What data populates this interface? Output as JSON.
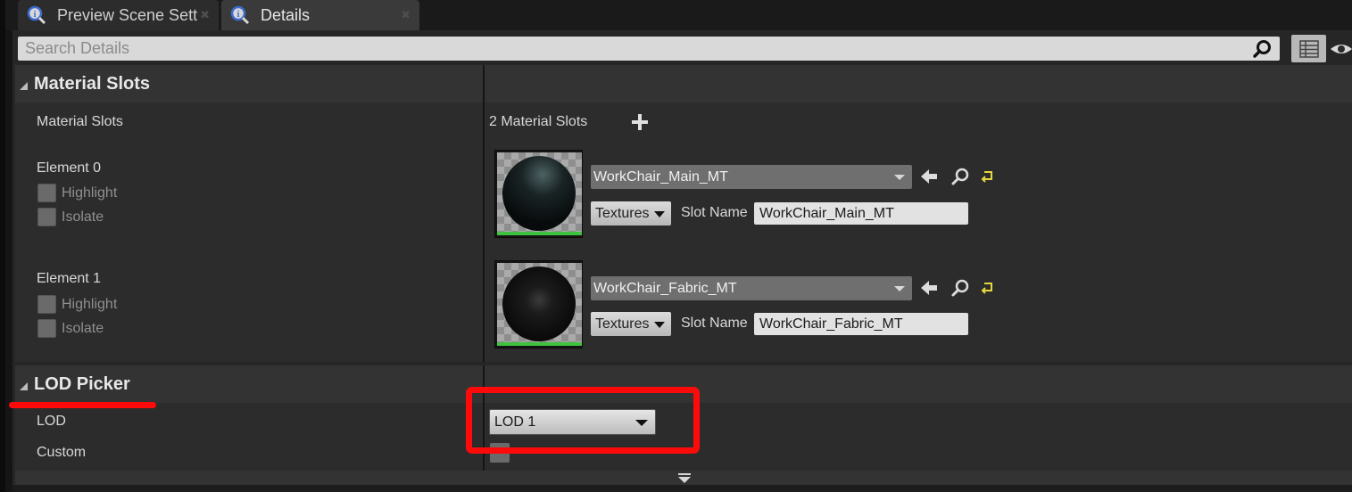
{
  "tabs": [
    {
      "label": "Preview Scene Sett",
      "active": false
    },
    {
      "label": "Details",
      "active": true
    }
  ],
  "search": {
    "placeholder": "Search Details"
  },
  "material_slots": {
    "header": "Material Slots",
    "row_label": "Material Slots",
    "count_text": "2 Material Slots",
    "elements": [
      {
        "label": "Element 0",
        "highlight_label": "Highlight",
        "isolate_label": "Isolate",
        "material": "WorkChair_Main_MT",
        "textures_label": "Textures",
        "slot_name_label": "Slot Name",
        "slot_name": "WorkChair_Main_MT"
      },
      {
        "label": "Element 1",
        "highlight_label": "Highlight",
        "isolate_label": "Isolate",
        "material": "WorkChair_Fabric_MT",
        "textures_label": "Textures",
        "slot_name_label": "Slot Name",
        "slot_name": "WorkChair_Fabric_MT"
      }
    ]
  },
  "lod_picker": {
    "header": "LOD Picker",
    "lod_label": "LOD",
    "lod_value": "LOD 1",
    "custom_label": "Custom"
  },
  "colors": {
    "annotation_red": "#ff0a0a",
    "thumbnail_green": "#3fc23f",
    "reset_yellow": "#e8d640"
  }
}
